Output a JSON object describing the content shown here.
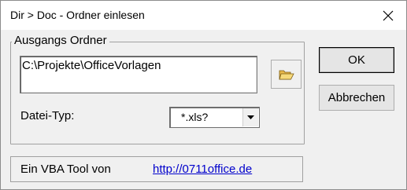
{
  "window": {
    "title": "Dir > Doc - Ordner einlesen",
    "close_icon": "close-icon"
  },
  "folder_group": {
    "legend": "Ausgangs Ordner",
    "path_value": "C:\\Projekte\\OfficeVorlagen",
    "browse_icon": "open-folder-icon"
  },
  "file_type": {
    "label": "Datei-Typ:",
    "selected": "*.xls?",
    "dropdown_icon": "chevron-down-icon"
  },
  "footer": {
    "text": "Ein VBA Tool von",
    "link": "http://0711office.de"
  },
  "buttons": {
    "ok": "OK",
    "cancel": "Abbrechen"
  },
  "colors": {
    "link": "#0000cc",
    "window_bg": "#f0f0f0",
    "folder_icon": "#e8b84a"
  }
}
